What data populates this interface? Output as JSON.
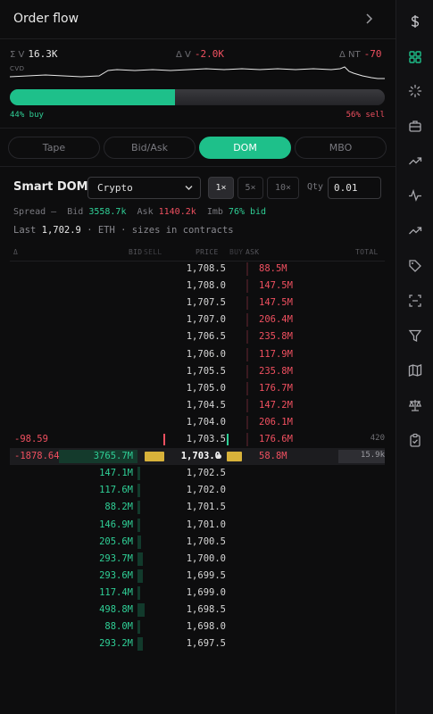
{
  "header": {
    "title": "Order flow"
  },
  "stats": {
    "sum_v_label": "Σ V",
    "sum_v": "16.3K",
    "delta_v_label": "Δ V",
    "delta_v": "-2.0K",
    "delta_nt_label": "Δ NT",
    "delta_nt": "-70",
    "cvd_label": "CVD"
  },
  "buy_sell": {
    "buy_fraction": 0.44,
    "buy_label": "44% buy",
    "sell_label": "56% sell"
  },
  "tabs": [
    {
      "label": "Tape"
    },
    {
      "label": "Bid/Ask"
    },
    {
      "label": "DOM",
      "active": true
    },
    {
      "label": "MBO"
    }
  ],
  "smart_dom": {
    "title": "Smart DOM",
    "market": "Crypto",
    "zoom_options": [
      "1×",
      "5×",
      "10×"
    ],
    "zoom_selected": "1×",
    "qty_label": "Qty",
    "qty_value": "0.01"
  },
  "info": {
    "spread_label": "Spread",
    "spread_value": "—",
    "bid_label": "Bid",
    "bid_value": "3558.7k",
    "ask_label": "Ask",
    "ask_value": "1140.2k",
    "imb_label": "Imb",
    "imb_value": "76% bid",
    "last_label": "Last",
    "last_value": "1,702.9",
    "symbol": "ETH",
    "note": "sizes in contracts"
  },
  "columns": {
    "delta": "Δ",
    "bid": "BID",
    "sell": "SELL",
    "price": "PRICE",
    "buy": "BUY",
    "ask": "ASK",
    "total": "TOTAL"
  },
  "asks": [
    {
      "price": "1,708.5",
      "ask": "88.5M",
      "level": 0.3
    },
    {
      "price": "1,708.0",
      "ask": "147.5M",
      "level": 0.55
    },
    {
      "price": "1,707.5",
      "ask": "147.5M",
      "level": 0.55
    },
    {
      "price": "1,707.0",
      "ask": "206.4M",
      "level": 0.75
    },
    {
      "price": "1,706.5",
      "ask": "235.8M",
      "level": 0.85
    },
    {
      "price": "1,706.0",
      "ask": "117.9M",
      "level": 0.45
    },
    {
      "price": "1,705.5",
      "ask": "235.8M",
      "level": 0.85
    },
    {
      "price": "1,705.0",
      "ask": "176.7M",
      "level": 0.65
    },
    {
      "price": "1,704.5",
      "ask": "147.2M",
      "level": 0.55
    },
    {
      "price": "1,704.0",
      "ask": "206.1M",
      "level": 0.75
    },
    {
      "price": "1,703.5",
      "ask": "176.6M",
      "level": 0.65,
      "delta": "-98.59",
      "total": "420"
    }
  ],
  "current": {
    "delta": "-1878.64",
    "bid": "3765.7M",
    "price": "1,703.0",
    "ask": "58.8M",
    "total": "15.9k"
  },
  "bids": [
    {
      "price": "1,702.5",
      "bid": "147.1M",
      "level": 0.35
    },
    {
      "price": "1,702.0",
      "bid": "117.6M",
      "level": 0.25
    },
    {
      "price": "1,701.5",
      "bid": "88.2M",
      "level": 0.2
    },
    {
      "price": "1,701.0",
      "bid": "146.9M",
      "level": 0.35
    },
    {
      "price": "1,700.5",
      "bid": "205.6M",
      "level": 0.5
    },
    {
      "price": "1,700.0",
      "bid": "293.7M",
      "level": 0.7
    },
    {
      "price": "1,699.5",
      "bid": "293.6M",
      "level": 0.7
    },
    {
      "price": "1,699.0",
      "bid": "117.4M",
      "level": 0.25
    },
    {
      "price": "1,698.5",
      "bid": "498.8M",
      "level": 1.0
    },
    {
      "price": "1,698.0",
      "bid": "88.0M",
      "level": 0.2
    },
    {
      "price": "1,697.5",
      "bid": "293.2M",
      "level": 0.7
    }
  ],
  "rail_icons": [
    "dollar-icon",
    "grid-icon",
    "loader-icon",
    "briefcase-icon",
    "trend-up-icon",
    "pulse-icon",
    "trend-up-icon",
    "tag-icon",
    "scan-icon",
    "filter-icon",
    "map-icon",
    "scale-icon",
    "clipboard-icon"
  ],
  "colors": {
    "accent": "#1ec08a",
    "sell": "#f05060",
    "highlight": "#d8b23a"
  }
}
